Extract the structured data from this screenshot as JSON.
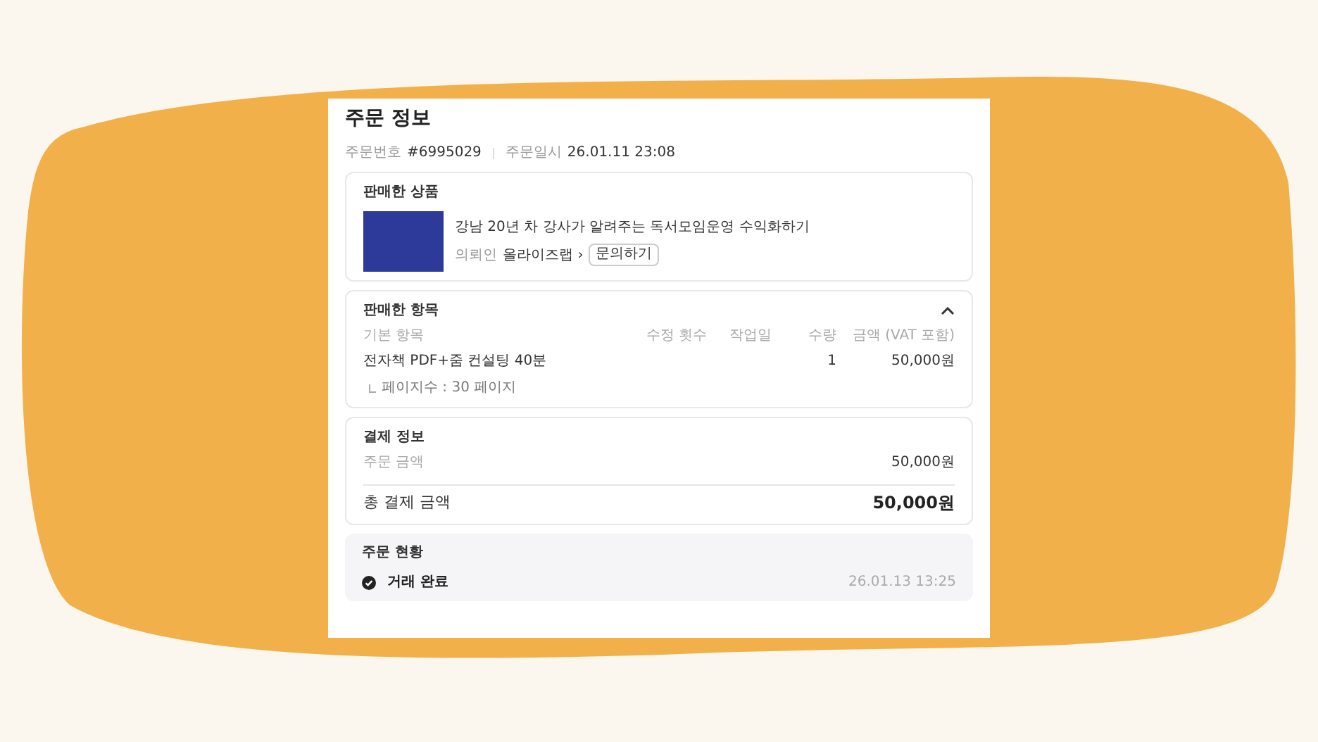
{
  "page": {
    "title": "주문 정보",
    "order_number_label": "주문번호",
    "order_number": "#6995029",
    "order_date_label": "주문일시",
    "order_date": "26.01.11 23:08"
  },
  "product": {
    "heading": "판매한 상품",
    "name": "강남 20년 차 강사가 알려주는 독서모임운영 수익화하기",
    "buyer_label": "의뢰인",
    "buyer": "올라이즈랩",
    "buyer_arrow": "›",
    "contact_button": "문의하기"
  },
  "items": {
    "heading": "판매한 항목",
    "expanded": true,
    "columns": [
      "기본 항목",
      "수정 횟수",
      "작업일",
      "수량",
      "금액 (VAT 포함)"
    ],
    "rows": [
      {
        "name": "전자책 PDF+줌 컨설팅 40분",
        "revisions": "",
        "days": "",
        "quantity": "1",
        "price": "50,000원",
        "option": "페이지수 : 30 페이지"
      }
    ]
  },
  "payment": {
    "heading": "결제 정보",
    "order_amount_label": "주문 금액",
    "order_amount": "50,000원",
    "total_label": "총 결제 금액",
    "total": "50,000원"
  },
  "status": {
    "heading": "주문 현황",
    "steps": [
      {
        "label": "거래 완료",
        "time": "26.01.13 13:25",
        "done": true
      }
    ]
  }
}
